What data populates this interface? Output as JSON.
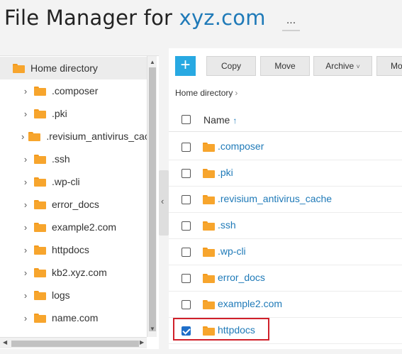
{
  "header": {
    "title_prefix": "File Manager for ",
    "domain": "xyz.com",
    "more_label": "..."
  },
  "tree": {
    "root_label": "Home directory",
    "items": [
      {
        "label": ".composer"
      },
      {
        "label": ".pki"
      },
      {
        "label": ".revisium_antivirus_cache"
      },
      {
        "label": ".ssh"
      },
      {
        "label": ".wp-cli"
      },
      {
        "label": "error_docs"
      },
      {
        "label": "example2.com"
      },
      {
        "label": "httpdocs"
      },
      {
        "label": "kb2.xyz.com"
      },
      {
        "label": "logs"
      },
      {
        "label": "name.com"
      }
    ]
  },
  "toolbar": {
    "add_label": "+",
    "copy_label": "Copy",
    "move_label": "Move",
    "archive_label": "Archive",
    "archive_caret": "˅",
    "more_label": "Mo"
  },
  "breadcrumb": {
    "label": "Home directory",
    "separator": "›"
  },
  "list": {
    "name_header": "Name",
    "sort_indicator": "↑",
    "files": [
      {
        "name": ".composer",
        "checked": false
      },
      {
        "name": ".pki",
        "checked": false
      },
      {
        "name": ".revisium_antivirus_cache",
        "checked": false
      },
      {
        "name": ".ssh",
        "checked": false
      },
      {
        "name": ".wp-cli",
        "checked": false
      },
      {
        "name": "error_docs",
        "checked": false
      },
      {
        "name": "example2.com",
        "checked": false
      },
      {
        "name": "httpdocs",
        "checked": true
      }
    ]
  },
  "colors": {
    "accent": "#1f7ab8",
    "add_button": "#28a9e2",
    "folder": "#f7a52d",
    "highlight": "#d0202a",
    "checkbox_checked": "#1f6fc9"
  },
  "icons": {
    "folder": "folder-icon",
    "chevron": "chevron-right-icon",
    "collapse": "chevron-left-icon"
  }
}
